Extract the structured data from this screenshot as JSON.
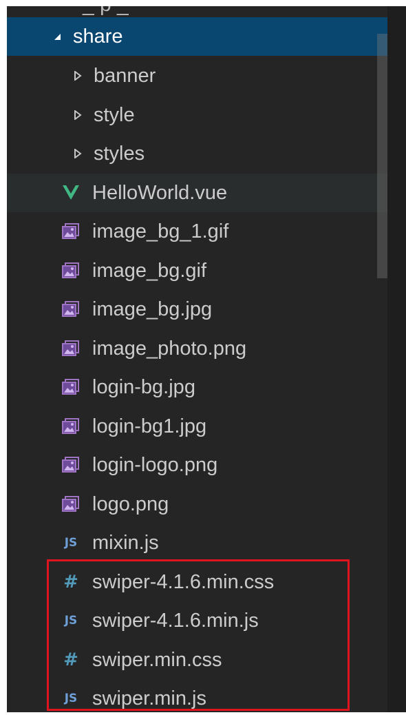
{
  "explorer": {
    "cut_off_label": "_ p _",
    "folder": {
      "name": "share",
      "expanded": true
    },
    "items": [
      {
        "label": "banner",
        "kind": "folder",
        "icon": "chevron-right-icon"
      },
      {
        "label": "style",
        "kind": "folder",
        "icon": "chevron-right-icon"
      },
      {
        "label": "styles",
        "kind": "folder",
        "icon": "chevron-right-icon"
      },
      {
        "label": "HelloWorld.vue",
        "kind": "vue",
        "icon": "vue-icon"
      },
      {
        "label": "image_bg_1.gif",
        "kind": "image",
        "icon": "image-icon"
      },
      {
        "label": "image_bg.gif",
        "kind": "image",
        "icon": "image-icon"
      },
      {
        "label": "image_bg.jpg",
        "kind": "image",
        "icon": "image-icon"
      },
      {
        "label": "image_photo.png",
        "kind": "image",
        "icon": "image-icon"
      },
      {
        "label": "login-bg.jpg",
        "kind": "image",
        "icon": "image-icon"
      },
      {
        "label": "login-bg1.jpg",
        "kind": "image",
        "icon": "image-icon"
      },
      {
        "label": "login-logo.png",
        "kind": "image",
        "icon": "image-icon"
      },
      {
        "label": "logo.png",
        "kind": "image",
        "icon": "image-icon"
      },
      {
        "label": "mixin.js",
        "kind": "js",
        "icon": "js-icon"
      },
      {
        "label": "swiper-4.1.6.min.css",
        "kind": "css",
        "icon": "hash-icon"
      },
      {
        "label": "swiper-4.1.6.min.js",
        "kind": "js",
        "icon": "js-icon"
      },
      {
        "label": "swiper.min.css",
        "kind": "css",
        "icon": "hash-icon"
      },
      {
        "label": "swiper.min.js",
        "kind": "js",
        "icon": "js-icon"
      }
    ],
    "icon_text": {
      "js": "JS",
      "css": "#"
    }
  },
  "colors": {
    "selected_bg": "#094771",
    "explorer_bg": "#252526",
    "highlight_border": "#e0141e",
    "vue_green": "#41b883",
    "image_purple": "#a074c4"
  }
}
